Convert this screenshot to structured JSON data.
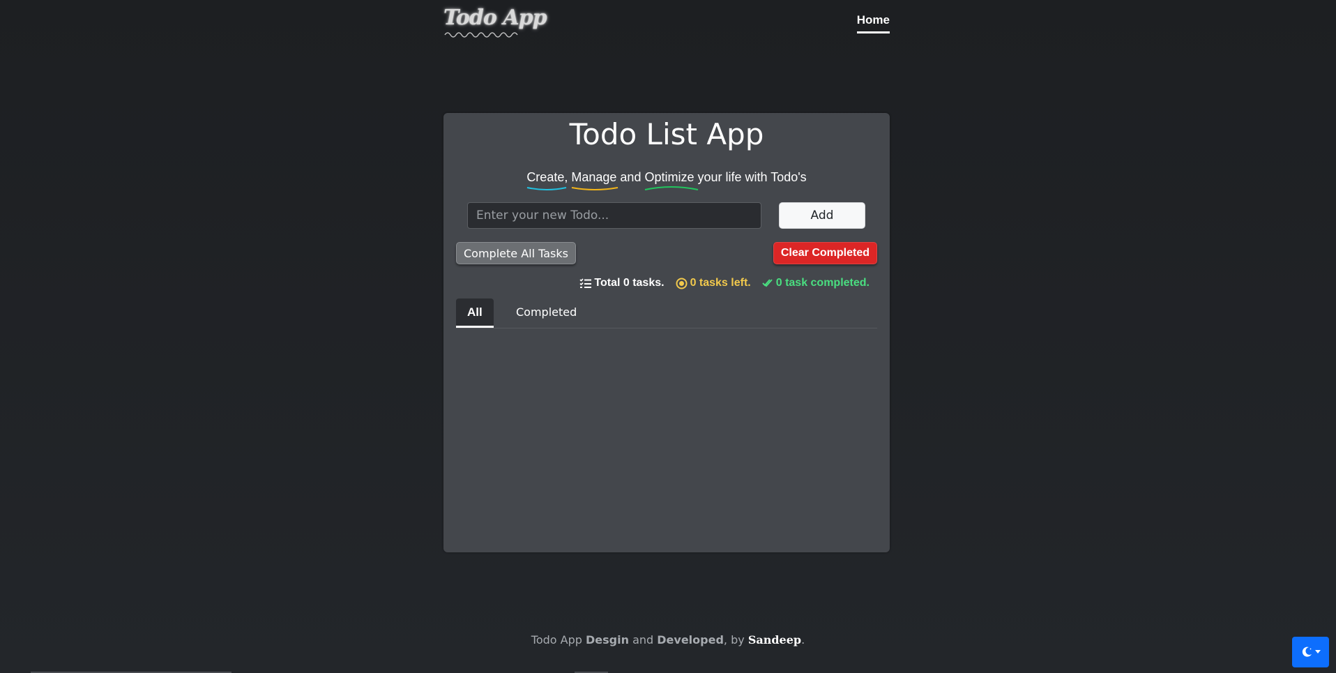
{
  "navbar": {
    "logo_text": "Todo App",
    "home_label": "Home"
  },
  "card": {
    "title": "Todo List App",
    "subtitle": {
      "word1": "Create",
      "sep1": ", ",
      "word2": "Manage",
      "sep2": " and ",
      "word3": "Optimize",
      "rest": " your life with Todo's"
    },
    "input_placeholder": "Enter your new Todo...",
    "add_label": "Add",
    "complete_all_label": "Complete All Tasks",
    "clear_completed_label": "Clear Completed",
    "stats": {
      "total": "Total 0 tasks.",
      "left": "0 tasks left.",
      "completed": "0 task completed."
    },
    "tabs": {
      "all": "All",
      "completed": "Completed"
    }
  },
  "footer": {
    "prefix": "Todo App ",
    "design": "Desgin",
    "and": " and ",
    "developed": "Developed",
    "by": ", by ",
    "author": "Sandeep",
    "end": "."
  },
  "colors": {
    "accent_blue": "#0d6efd",
    "danger_red": "#dc2626",
    "stat_yellow": "#f2c94c",
    "stat_green": "#4ade80",
    "underline_cyan": "#22c1e0",
    "underline_yellow": "#f2b51a",
    "underline_green": "#22c55e"
  },
  "icons": {
    "theme_toggle": "moon-icon",
    "stat_total": "list-check-icon",
    "stat_left": "circle-dot-icon",
    "stat_done": "double-check-icon"
  }
}
